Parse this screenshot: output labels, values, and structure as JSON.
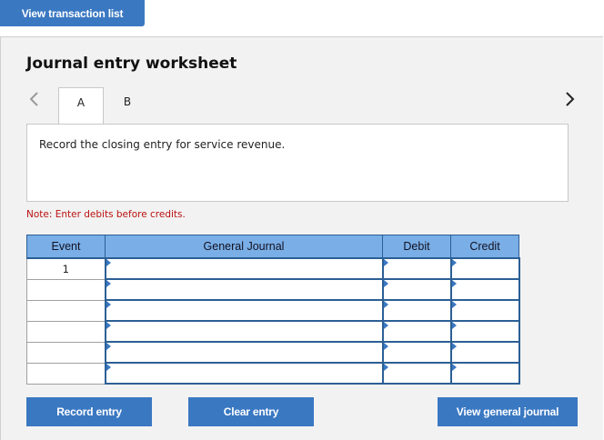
{
  "toolbar": {
    "view_transactions_label": "View transaction list"
  },
  "worksheet": {
    "title": "Journal entry worksheet",
    "tabs": [
      {
        "label": "A",
        "active": true
      },
      {
        "label": "B",
        "active": false
      }
    ],
    "prev_icon": "chevron-left-icon",
    "next_icon": "chevron-right-icon",
    "instruction": "Record the closing entry for service revenue.",
    "note": "Note: Enter debits before credits."
  },
  "journal": {
    "headers": {
      "event": "Event",
      "general_journal": "General Journal",
      "debit": "Debit",
      "credit": "Credit"
    },
    "rows": [
      {
        "event": "1",
        "account": "",
        "debit": "",
        "credit": ""
      },
      {
        "event": "",
        "account": "",
        "debit": "",
        "credit": ""
      },
      {
        "event": "",
        "account": "",
        "debit": "",
        "credit": ""
      },
      {
        "event": "",
        "account": "",
        "debit": "",
        "credit": ""
      },
      {
        "event": "",
        "account": "",
        "debit": "",
        "credit": ""
      },
      {
        "event": "",
        "account": "",
        "debit": "",
        "credit": ""
      }
    ]
  },
  "actions": {
    "record_label": "Record entry",
    "clear_label": "Clear entry",
    "view_journal_label": "View general journal"
  },
  "colors": {
    "accent": "#3a78c2",
    "header_bg": "#7aaee6",
    "border_dark": "#2c5f95",
    "note_text": "#bb1111",
    "panel_bg": "#f2f2f2"
  }
}
